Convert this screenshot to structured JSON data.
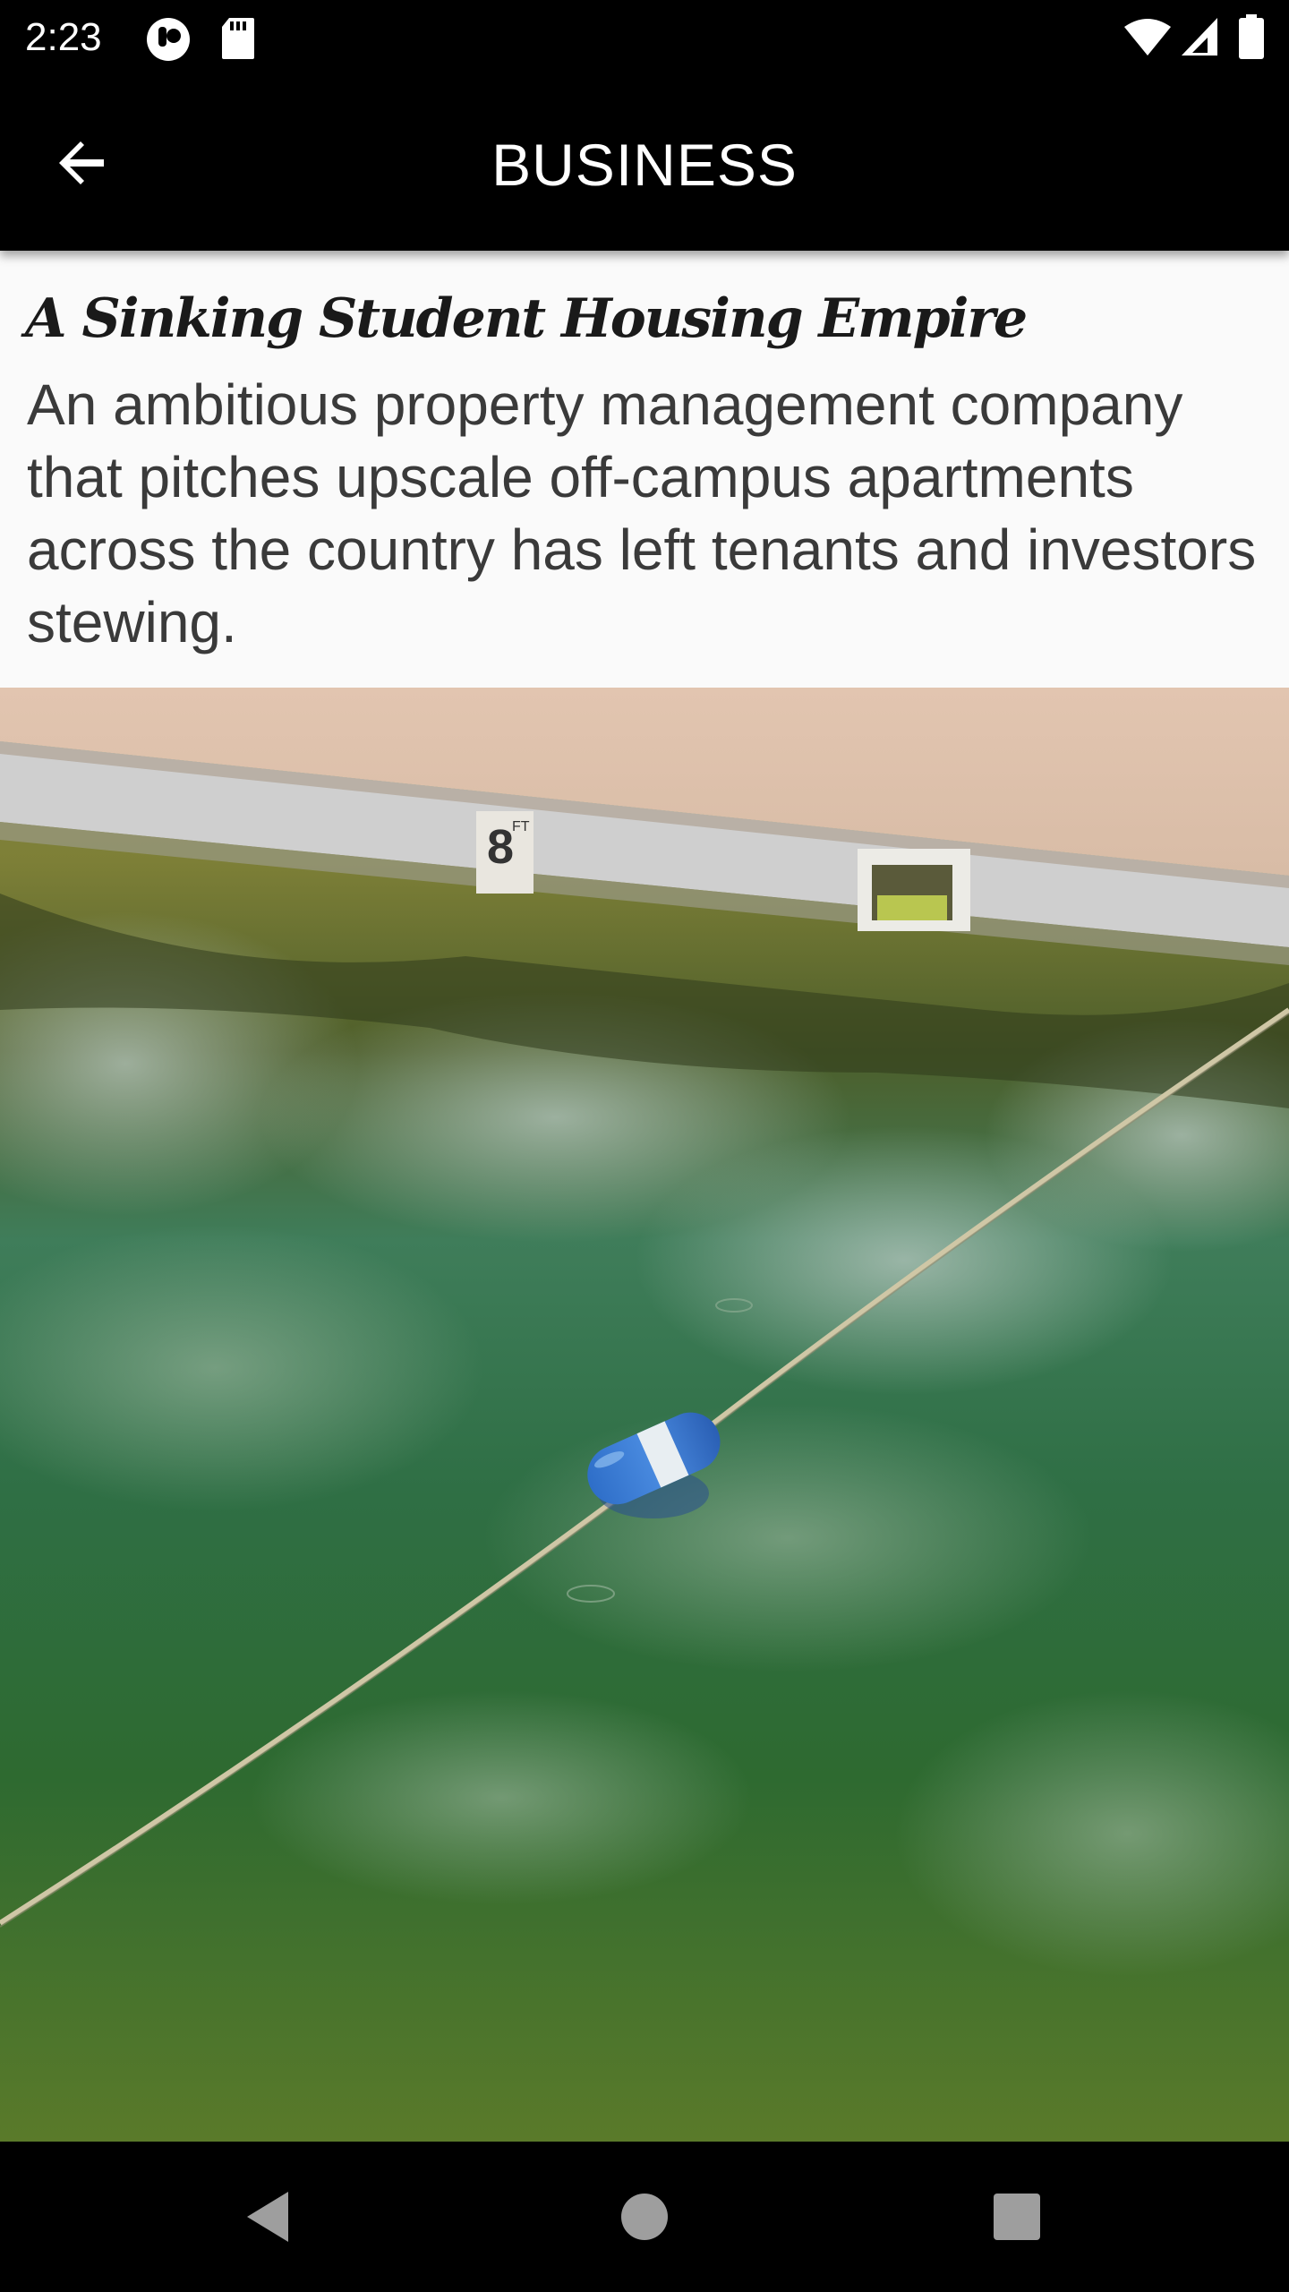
{
  "status_bar": {
    "time": "2:23",
    "left_icons": [
      "media-app-icon",
      "sd-card-icon"
    ],
    "right_icons": [
      "wifi-icon",
      "cell-signal-icon",
      "battery-icon"
    ]
  },
  "app_bar": {
    "title": "BUSINESS",
    "back_icon": "arrow-left-icon"
  },
  "article": {
    "headline": "A Sinking Student Housing Empire",
    "summary": "An ambitious property management company that pitches upscale off-campus apartments across the country has left tenants and investors stewing.",
    "image_depth_markers": [
      "8",
      "FT"
    ]
  },
  "nav_bar": {
    "buttons": [
      "back-triangle-icon",
      "home-circle-icon",
      "recents-square-icon"
    ]
  },
  "colors": {
    "bar_background": "#000000",
    "content_background": "#fafafa",
    "headline_text": "#1a1a1a",
    "summary_text": "#3a3a3a",
    "nav_icons": "#9e9e9e"
  }
}
